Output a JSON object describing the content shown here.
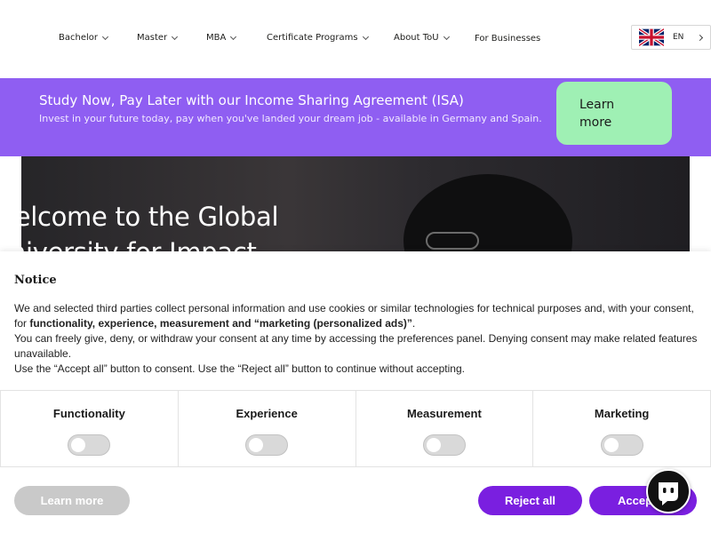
{
  "nav": {
    "items": [
      {
        "label": "Bachelor"
      },
      {
        "label": "Master"
      },
      {
        "label": "MBA"
      },
      {
        "label": "Certificate Programs"
      },
      {
        "label": "About ToU"
      },
      {
        "label": "For Businesses"
      }
    ],
    "language": {
      "code": "EN",
      "flag": "uk-flag-icon"
    }
  },
  "isa_banner": {
    "title": "Study Now, Pay Later with our Income Sharing Agreement (ISA)",
    "subtitle": "Invest in your future today, pay when you've landed your dream job - available in Germany and Spain.",
    "button_line1": "Learn",
    "button_line2": "more",
    "background": "#8f5ef2",
    "button_color": "#9ff0b4"
  },
  "hero": {
    "title_line1": "Welcome to the Global",
    "title_line2": "University for Impact"
  },
  "consent": {
    "title": "Notice",
    "body_p1_a": "We and selected third parties collect personal information and use cookies or similar technologies for technical purposes and, with your consent, for ",
    "body_p1_bold": "functionality, experience, measurement and “marketing (personalized ads)”",
    "body_p1_end": ".",
    "body_p2": "You can freely give, deny, or withdraw your consent at any time by accessing the preferences panel. Denying consent may make related features unavailable.",
    "body_p3": "Use the “Accept all” button to consent. Use the “Reject all” button to continue without accepting.",
    "categories": [
      {
        "label": "Functionality",
        "enabled": false
      },
      {
        "label": "Experience",
        "enabled": false
      },
      {
        "label": "Measurement",
        "enabled": false
      },
      {
        "label": "Marketing",
        "enabled": false
      }
    ],
    "learn_more": "Learn more",
    "reject_all": "Reject all",
    "accept_all": "Accept all",
    "accent_color": "#7a1fe0"
  },
  "chat_widget": {
    "icon": "chat-bot-icon"
  }
}
